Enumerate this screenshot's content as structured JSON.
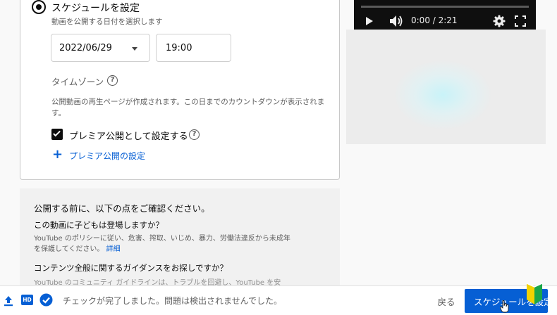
{
  "schedule": {
    "title": "スケジュールを設定",
    "subtitle": "動画を公開する日付を選択します",
    "date_value": "2022/06/29",
    "time_value": "19:00",
    "timezone_label": "タイムゾーン",
    "premiere_note": "公開動画の再生ページが作成されます。この日までのカウントダウンが表示されます。",
    "premiere_checkbox_label": "プレミア公開として設定する",
    "premiere_checked": true,
    "premiere_settings_link": "プレミア公開の設定"
  },
  "player": {
    "time_display": "0:00 / 2:21",
    "icons": [
      "play-icon",
      "volume-icon",
      "settings-icon",
      "fullscreen-icon"
    ]
  },
  "checks": {
    "heading": "公開する前に、以下の点をご確認ください。",
    "kids_question": "この動画に子どもは登場しますか？",
    "kids_body": "YouTube のポリシーに従い、危害、搾取、いじめ、暴力、労働法違反から未成年を保護してください。",
    "kids_link": "詳細",
    "guide_question": "コンテンツ全般に関するガイダンスをお探しですか？",
    "guide_body": "YouTube のコミュニティ ガイドラインは、トラブルを回避し、YouTube を安"
  },
  "footer": {
    "hd_badge": "HD",
    "status": "チェックが完了しました。問題は検出されませんでした。",
    "back_label": "戻る",
    "schedule_label": "スケジュールを設定"
  },
  "colors": {
    "accent": "#065fd4",
    "text_secondary": "#606060",
    "player_bg": "#0f0f0f"
  }
}
